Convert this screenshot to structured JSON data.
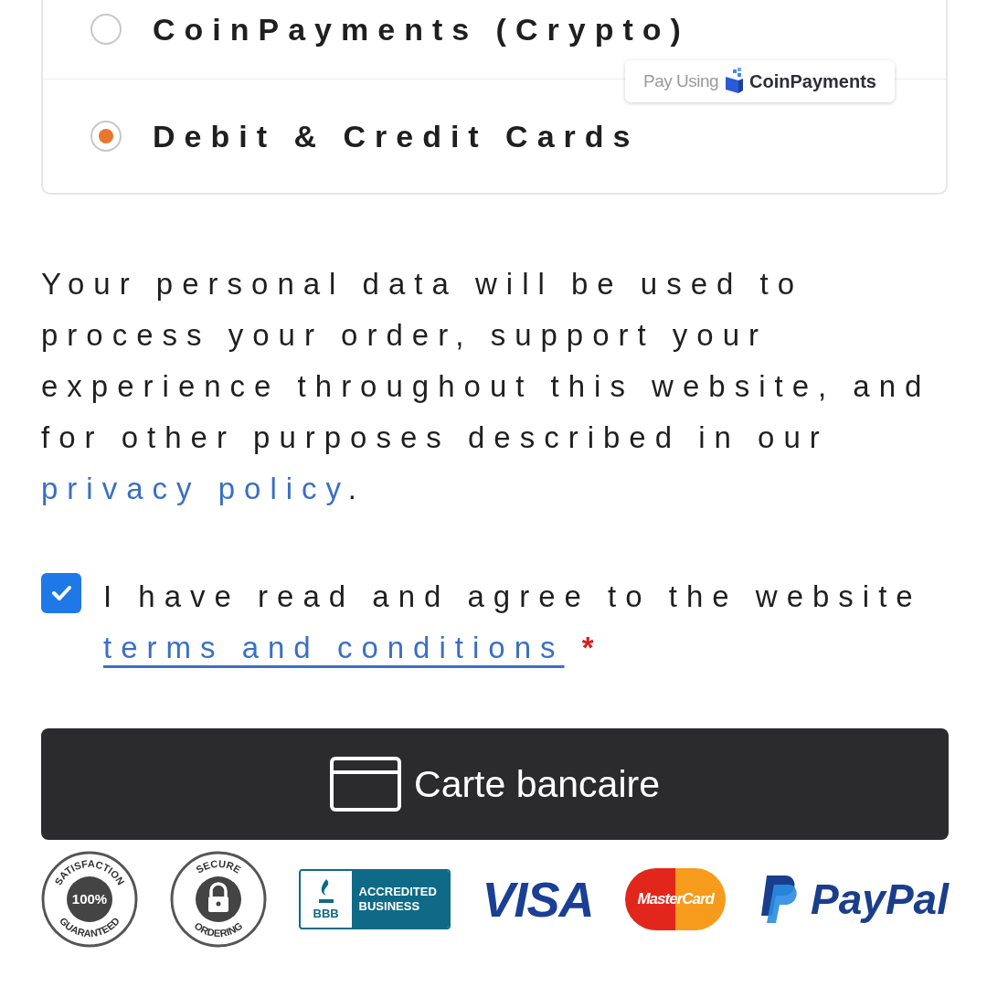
{
  "payment_methods": [
    {
      "label": "CoinPayments (Crypto)",
      "selected": false,
      "badge": {
        "prefix": "Pay Using",
        "brand": "CoinPayments"
      }
    },
    {
      "label": "Debit & Credit Cards",
      "selected": true
    }
  ],
  "privacy_notice": {
    "text": "Your personal data will be used to process your order, support your experience throughout this website, and for other purposes described in our",
    "link": "privacy policy",
    "end": "."
  },
  "terms": {
    "checked": true,
    "text": "I have read and agree to the website",
    "link": "terms and conditions",
    "required_mark": "*"
  },
  "pay_button": {
    "label": "Carte bancaire"
  },
  "trust_badges": [
    {
      "kind": "seal",
      "top": "SATISFACTION",
      "center": "100%",
      "bottom": "GUARANTEED"
    },
    {
      "kind": "seal-lock",
      "top": "SECURE",
      "bottom": "ORDERING"
    },
    {
      "kind": "bbb",
      "mark": "BBB",
      "text": "ACCREDITED BUSINESS"
    },
    {
      "kind": "visa",
      "text": "VISA"
    },
    {
      "kind": "mastercard",
      "text": "MasterCard"
    },
    {
      "kind": "paypal",
      "text": "PayPal"
    }
  ]
}
